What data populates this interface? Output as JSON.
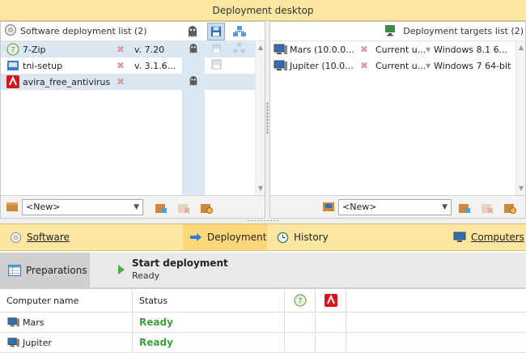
{
  "window": {
    "title": "Deployment desktop"
  },
  "left_pane": {
    "title": "Software deployment list (2)",
    "header_icons": [
      "ghost-icon",
      "floppy-icon",
      "network-icon"
    ],
    "rows": [
      {
        "name": "7-Zip",
        "version": "v. 7.20",
        "icon": "7zip-icon",
        "selected": true
      },
      {
        "name": "tni-setup",
        "version": "v. 3.1.6...",
        "icon": "tni-setup-icon",
        "selected": false
      },
      {
        "name": "avira_free_antivirus",
        "version": "",
        "icon": "avira-icon",
        "selected": true
      }
    ],
    "footer": {
      "combo_value": "<New>"
    }
  },
  "right_pane": {
    "title": "Deployment targets list (2)",
    "rows": [
      {
        "name": "Mars (10.0.0...",
        "user": "Current u...",
        "os": "Windows 8.1 6..."
      },
      {
        "name": "Jupiter (10.0...",
        "user": "Current u...",
        "os": "Windows 7 64-bit"
      }
    ],
    "footer": {
      "combo_value": "<New>"
    }
  },
  "nav": {
    "software": "Software",
    "deployment": "Deployment",
    "history": "History",
    "computers": "Computers",
    "active": "Deployment"
  },
  "steps": {
    "preparations": "Preparations",
    "start_title": "Start deployment",
    "start_status": "Ready"
  },
  "results": {
    "columns": [
      "Computer name",
      "Status"
    ],
    "rows": [
      {
        "computer": "Mars",
        "status": "Ready"
      },
      {
        "computer": "Jupiter",
        "status": "Ready"
      }
    ]
  },
  "colors": {
    "banner": "#fbe7a1",
    "active_nav": "#fdd77a",
    "ready": "#3ca03c",
    "selection": "#dbe7f2"
  }
}
